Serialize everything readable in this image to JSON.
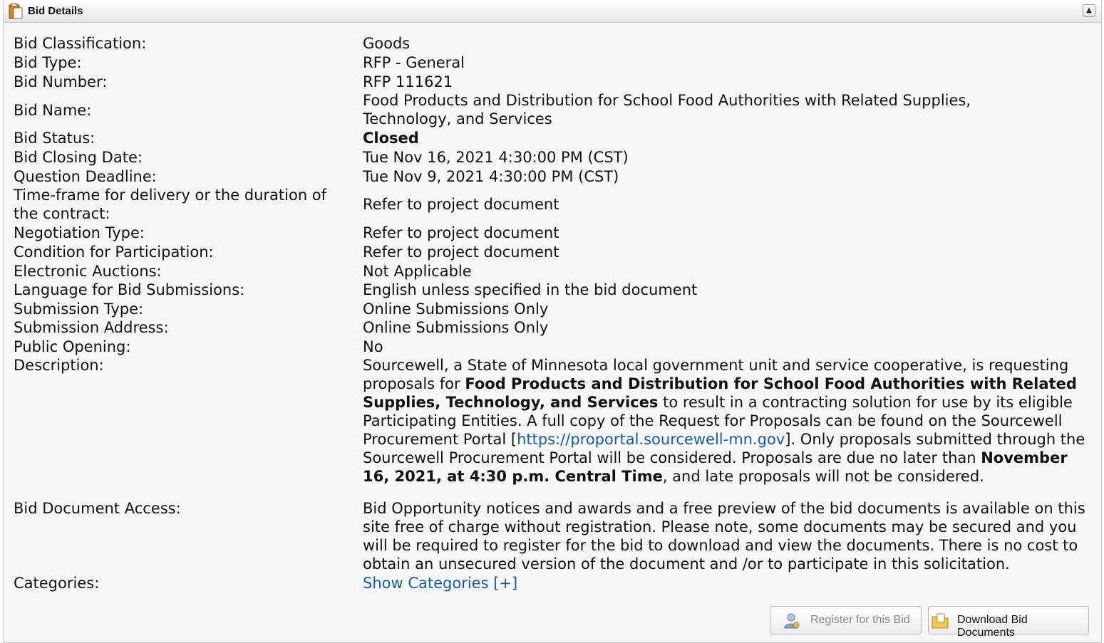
{
  "panel": {
    "title": "Bid Details",
    "collapse_symbol": "▲"
  },
  "fields": {
    "classification": {
      "label": "Bid Classification:",
      "value": "Goods"
    },
    "type": {
      "label": "Bid Type:",
      "value": "RFP - General"
    },
    "number": {
      "label": "Bid Number:",
      "value": "RFP 111621"
    },
    "name": {
      "label": "Bid Name:",
      "value": "Food Products and Distribution for School Food Authorities with Related Supplies, Technology, and Services"
    },
    "status": {
      "label": "Bid Status:",
      "value": "Closed"
    },
    "closing_date": {
      "label": "Bid Closing Date:",
      "value": "Tue Nov 16, 2021 4:30:00 PM (CST)"
    },
    "question_deadline": {
      "label": "Question Deadline:",
      "value": "Tue Nov 9, 2021 4:30:00 PM (CST)"
    },
    "timeframe": {
      "label": "Time-frame for delivery or the duration of the contract:",
      "value": "Refer to project document"
    },
    "negotiation": {
      "label": "Negotiation Type:",
      "value": "Refer to project document"
    },
    "condition": {
      "label": "Condition for Participation:",
      "value": "Refer to project document"
    },
    "auctions": {
      "label": "Electronic Auctions:",
      "value": "Not Applicable"
    },
    "language": {
      "label": "Language for Bid Submissions:",
      "value": "English unless specified in the bid document"
    },
    "submission_type": {
      "label": "Submission Type:",
      "value": "Online Submissions Only"
    },
    "submission_address": {
      "label": "Submission Address:",
      "value": "Online Submissions Only"
    },
    "public_opening": {
      "label": "Public Opening:",
      "value": "No"
    },
    "description": {
      "label": "Description:",
      "p1": "Sourcewell, a State of Minnesota local government unit and service cooperative, is requesting proposals for ",
      "b1": "Food Products and Distribution for School Food Authorities with Related Supplies, Technology, and Services",
      "p2": " to result in a contracting solution for use by its eligible Participating Entities.  A full copy of the Request for Proposals can be found on the Sourcewell Procurement Portal [",
      "link": "https://proportal.sourcewell-mn.gov",
      "p3": "]. Only proposals submitted through the Sourcewell Procurement Portal will be considered. Proposals are due no later than ",
      "b2": "November 16, 2021, at 4:30 p.m. Central Time",
      "p4": ", and late proposals will not be considered."
    },
    "doc_access": {
      "label": "Bid Document Access:",
      "value": "Bid Opportunity notices and awards and a free preview of the bid documents is available on this site free of charge without registration. Please note, some documents may be secured and you will be required to register for the bid to download and view the documents. There is no cost to obtain an unsecured version of the document and /or to participate in this solicitation."
    },
    "categories": {
      "label": "Categories:",
      "link": "Show Categories [+]"
    }
  },
  "buttons": {
    "register": "Register for this Bid",
    "download": "Download Bid Documents"
  },
  "icons": {
    "header": "clipboard-icon",
    "register": "user-add-icon",
    "download": "folder-download-icon"
  }
}
